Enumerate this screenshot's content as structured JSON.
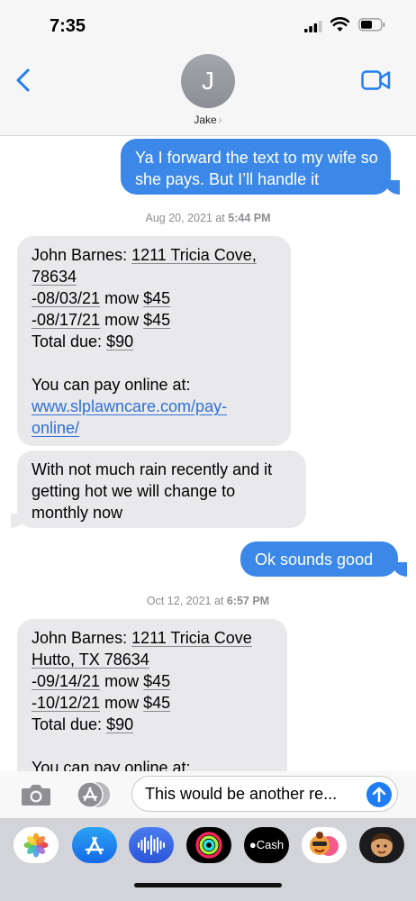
{
  "status_bar": {
    "time": "7:35"
  },
  "header": {
    "avatar_initial": "J",
    "contact_name": "Jake",
    "chevron": "›"
  },
  "thread": {
    "m1": {
      "text": "Ya I forward the text to my wife so she pays. But I’ll handle it"
    },
    "ts1": {
      "date": "Aug 20, 2021",
      "at": " at ",
      "time": "5:44 PM"
    },
    "m2": {
      "name": "John Barnes: ",
      "address_a": "1211 Tricia Cove,",
      "address_b": "78634",
      "line1_date": "-08/03/21",
      "line1_mid": " mow ",
      "line1_amount": "$45",
      "line2_date": "-08/17/21",
      "line2_mid": " mow ",
      "line2_amount": "$45",
      "total_label": "Total due: ",
      "total_amount": "$90",
      "pay_text": "You can pay online at:",
      "link_a": "www.slplawncare.com/pay-",
      "link_b": "online/"
    },
    "m3": {
      "text": "With not much rain recently and it getting hot we will change to monthly now"
    },
    "m4": {
      "text": "Ok sounds good"
    },
    "ts2": {
      "date": "Oct 12, 2021",
      "at": " at ",
      "time": "6:57 PM"
    },
    "m5": {
      "name": "John Barnes: ",
      "address_a": "1211 Tricia Cove",
      "address_b": "Hutto, TX 78634",
      "line1_date": "-09/14/21",
      "line1_mid": " mow ",
      "line1_amount": "$45",
      "line2_date": "-10/12/21",
      "line2_mid": " mow ",
      "line2_amount": "$45",
      "total_label": "Total due: ",
      "total_amount": "$90",
      "pay_text": "You can pay online at:"
    }
  },
  "input": {
    "value": "This would be another re..."
  },
  "app_drawer": {
    "apps": [
      "photos-icon",
      "app-store-icon",
      "audio-message-icon",
      "activity-icon",
      "apple-cash-icon",
      "memoji-stickers-icon",
      "memoji-icon"
    ],
    "cash_label": "Cash"
  },
  "colors": {
    "outgoing_bubble": "#3b88e8",
    "incoming_bubble": "#e9e9eb",
    "link": "#2f6fd6",
    "ios_blue": "#1f7cf4"
  }
}
